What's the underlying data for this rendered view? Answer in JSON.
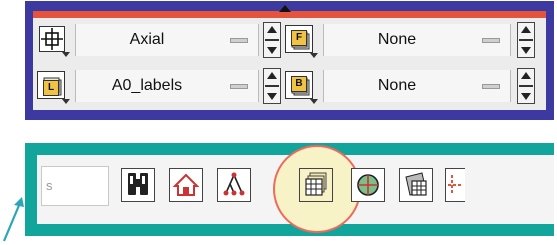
{
  "top_panel": {
    "row1": {
      "value": "Axial",
      "overlay_value": "None",
      "overlay_icon_letter": "F"
    },
    "row2": {
      "value": "A0_labels",
      "overlay_value": "None",
      "overlay_icon_letter": "B",
      "left_icon_letter": "L"
    }
  },
  "toolbar": {
    "search_partial_text": "s"
  },
  "colors": {
    "top_frame": "#3c3aa0",
    "top_accent": "#e6533c",
    "bottom_frame": "#11a59c",
    "highlight_fill": "#f8f3c6",
    "highlight_ring": "#f06a5c"
  },
  "icons": [
    "crosshair-icon",
    "layers-L-icon",
    "layers-F-icon",
    "layers-B-icon",
    "binoculars-icon",
    "home-icon",
    "tree-icon",
    "stacked-grid-icon",
    "target-icon",
    "angled-grid-icon",
    "partial-orange-icon"
  ]
}
